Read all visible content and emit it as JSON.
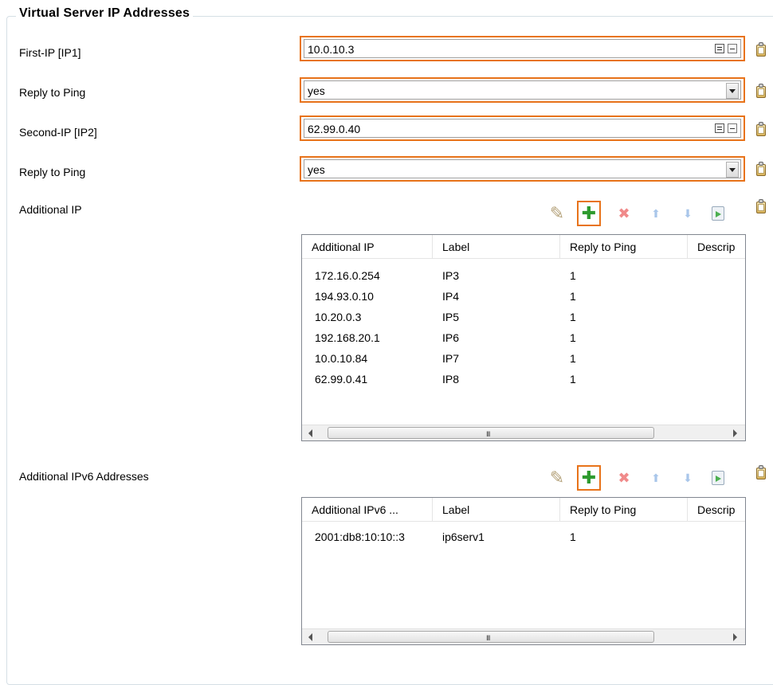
{
  "group": {
    "title": "Virtual Server IP Addresses"
  },
  "fields": {
    "first_ip": {
      "label": "First-IP [IP1]",
      "value": "10.0.10.3"
    },
    "reply1": {
      "label": "Reply to Ping",
      "value": "yes"
    },
    "second_ip": {
      "label": "Second-IP [IP2]",
      "value": "62.99.0.40"
    },
    "reply2": {
      "label": "Reply to Ping",
      "value": "yes"
    }
  },
  "additional_ip": {
    "label": "Additional IP",
    "columns": [
      "Additional IP",
      "Label",
      "Reply to Ping",
      "Descrip"
    ],
    "rows": [
      [
        "172.16.0.254",
        "IP3",
        "1"
      ],
      [
        "194.93.0.10",
        "IP4",
        "1"
      ],
      [
        "10.20.0.3",
        "IP5",
        "1"
      ],
      [
        "192.168.20.1",
        "IP6",
        "1"
      ],
      [
        "10.0.10.84",
        "IP7",
        "1"
      ],
      [
        "62.99.0.41",
        "IP8",
        "1"
      ]
    ],
    "scroll_grip": "III"
  },
  "additional_ipv6": {
    "label": "Additional IPv6 Addresses",
    "columns": [
      "Additional IPv6 ...",
      "Label",
      "Reply to Ping",
      "Descrip"
    ],
    "rows": [
      [
        "2001:db8:10:10::3",
        "ip6serv1",
        "1"
      ]
    ],
    "scroll_grip": "III"
  },
  "toolbar_icons": [
    "pencil-icon",
    "plus-icon",
    "delete-icon",
    "move-up-icon",
    "move-down-icon",
    "export-icon"
  ],
  "colors": {
    "highlight": "#e8731a",
    "add": "#2e9a2e"
  }
}
